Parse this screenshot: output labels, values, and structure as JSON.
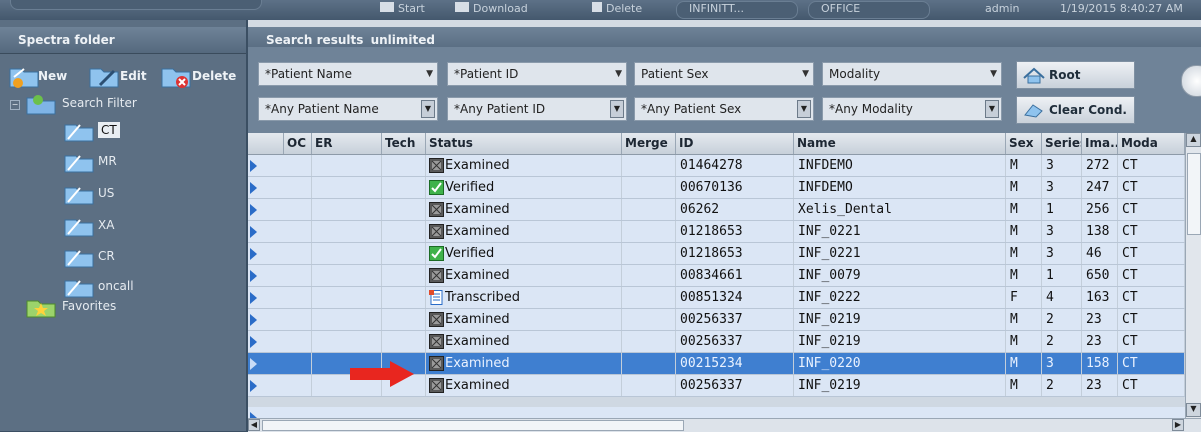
{
  "topbar": {
    "start_label": "Start",
    "download_label": "Download",
    "delete_label": "Delete",
    "dropdown1": "INFINITT...",
    "dropdown2": "OFFICE",
    "user": "admin",
    "datetime": "1/19/2015 8:40:27 AM"
  },
  "left": {
    "title": "Spectra folder",
    "new_label": "New",
    "edit_label": "Edit",
    "delete_label": "Delete",
    "search_filter": "Search Filter",
    "folders": [
      "CT",
      "MR",
      "US",
      "XA",
      "CR",
      "oncall"
    ],
    "selected_folder": "CT",
    "favorites": "Favorites"
  },
  "right": {
    "title": "Search results",
    "title_suffix": "unlimited",
    "filters_row1": [
      "*Patient Name",
      "*Patient ID",
      "Patient Sex",
      "Modality"
    ],
    "filters_row2": [
      "*Any Patient Name",
      "*Any Patient ID",
      "*Any Patient Sex",
      "*Any Modality"
    ],
    "root_label": "Root",
    "clear_label": "Clear Cond."
  },
  "table": {
    "columns": [
      "OC",
      "ER",
      "Tech",
      "Status",
      "Merge",
      "ID",
      "Name",
      "Sex",
      "Series",
      "Ima...",
      "Moda"
    ],
    "rows": [
      {
        "status": "Examined",
        "id": "01464278",
        "name": "INFDEMO",
        "sex": "M",
        "series": "3",
        "images": "272",
        "modality": "CT",
        "icon": "examined-icon"
      },
      {
        "status": "Verified",
        "id": "00670136",
        "name": "INFDEMO",
        "sex": "M",
        "series": "3",
        "images": "247",
        "modality": "CT",
        "icon": "verified-icon"
      },
      {
        "status": "Examined",
        "id": "06262",
        "name": "Xelis_Dental",
        "sex": "M",
        "series": "1",
        "images": "256",
        "modality": "CT",
        "icon": "examined-icon"
      },
      {
        "status": "Examined",
        "id": "01218653",
        "name": "INF_0221",
        "sex": "M",
        "series": "3",
        "images": "138",
        "modality": "CT",
        "icon": "examined-icon"
      },
      {
        "status": "Verified",
        "id": "01218653",
        "name": "INF_0221",
        "sex": "M",
        "series": "3",
        "images": "46",
        "modality": "CT",
        "icon": "verified-icon"
      },
      {
        "status": "Examined",
        "id": "00834661",
        "name": "INF_0079",
        "sex": "M",
        "series": "1",
        "images": "650",
        "modality": "CT",
        "icon": "examined-icon"
      },
      {
        "status": "Transcribed",
        "id": "00851324",
        "name": "INF_0222",
        "sex": "F",
        "series": "4",
        "images": "163",
        "modality": "CT",
        "icon": "transcribed-icon"
      },
      {
        "status": "Examined",
        "id": "00256337",
        "name": "INF_0219",
        "sex": "M",
        "series": "2",
        "images": "23",
        "modality": "CT",
        "icon": "examined-icon"
      },
      {
        "status": "Examined",
        "id": "00256337",
        "name": "INF_0219",
        "sex": "M",
        "series": "2",
        "images": "23",
        "modality": "CT",
        "icon": "examined-icon"
      },
      {
        "status": "Examined",
        "id": "00215234",
        "name": "INF_0220",
        "sex": "M",
        "series": "3",
        "images": "158",
        "modality": "CT",
        "icon": "examined-icon",
        "selected": true
      },
      {
        "status": "Examined",
        "id": "00256337",
        "name": "INF_0219",
        "sex": "M",
        "series": "2",
        "images": "23",
        "modality": "CT",
        "icon": "examined-icon"
      }
    ]
  },
  "colors": {
    "selection": "#3f7fd0",
    "row_bg": "#dbe6f5",
    "annotation_arrow": "#e8261f"
  }
}
